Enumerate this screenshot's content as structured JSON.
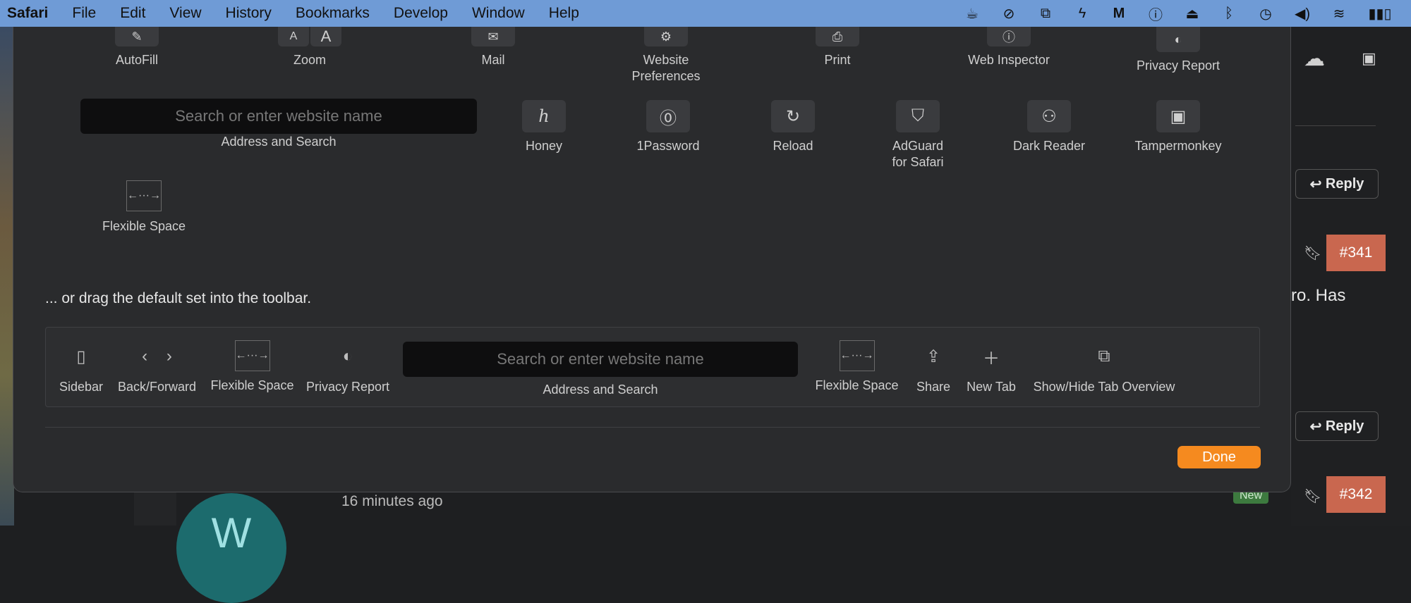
{
  "menubar": {
    "app": "Safari",
    "items": [
      "File",
      "Edit",
      "View",
      "History",
      "Bookmarks",
      "Develop",
      "Window",
      "Help"
    ],
    "status_icons": [
      "coffee-cup-icon",
      "circle-slash-icon",
      "screen-share-icon",
      "bolt-icon",
      "m-app-icon",
      "onepassword-icon",
      "airplay-icon",
      "bluetooth-icon",
      "time-machine-icon",
      "volume-icon",
      "wifi-icon",
      "battery-icon"
    ]
  },
  "sheet": {
    "row1": [
      "AutoFill",
      "Zoom",
      "Mail",
      "Website Preferences",
      "Print",
      "Web Inspector",
      "Privacy Report"
    ],
    "address_placeholder": "Search or enter website name",
    "address_label": "Address and Search",
    "row2": [
      "Honey",
      "1Password",
      "Reload",
      "AdGuard for Safari",
      "Dark Reader",
      "Tampermonkey"
    ],
    "flexible_space": "Flexible Space",
    "drag_text": "... or drag the default set into the toolbar.",
    "default_set": {
      "sidebar": "Sidebar",
      "backforward": "Back/Forward",
      "flex1": "Flexible Space",
      "privacy": "Privacy Report",
      "address_placeholder": "Search or enter website name",
      "address_label": "Address and Search",
      "flex2": "Flexible Space",
      "share": "Share",
      "newtab": "New Tab",
      "taboverview": "Show/Hide Tab Overview"
    },
    "done": "Done"
  },
  "background": {
    "reply1": "Reply",
    "reply2": "Reply",
    "badge1": "#341",
    "badge2": "#342",
    "partial_text": "ro. Has",
    "new_tag": "New",
    "time_ago": "16 minutes ago",
    "avatar_letter": "W"
  },
  "colors": {
    "accent": "#f58a1f",
    "badge": "#c9674f",
    "menubar": "#6f9bd6"
  }
}
